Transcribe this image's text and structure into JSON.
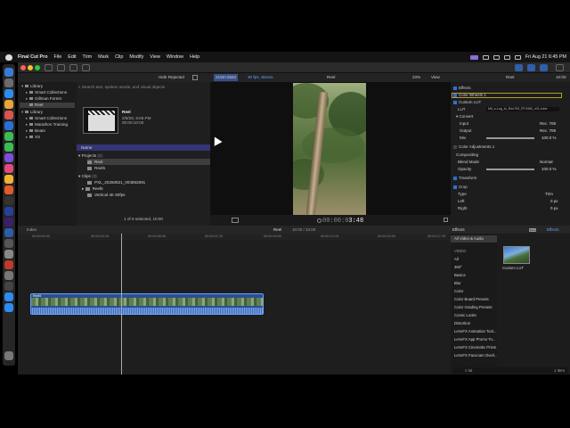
{
  "menubar": {
    "app_name": "Final Cut Pro",
    "items": [
      "File",
      "Edit",
      "Trim",
      "Mark",
      "Clip",
      "Modify",
      "View",
      "Window",
      "Help"
    ],
    "clock": "Fri Aug 21  6:45 PM"
  },
  "browser_header": {
    "filter": "Hide Rejected",
    "format": "2160×3840",
    "rate": "30 fps, Stereo"
  },
  "viewer_header": {
    "title": "Reel",
    "zoom": "23%",
    "view": "View"
  },
  "inspector_header": {
    "title": "Reel",
    "duration": "10:00"
  },
  "sidebar": {
    "items": [
      {
        "label": "Library",
        "kind": "library"
      },
      {
        "label": "Smart Collections",
        "kind": "folder"
      },
      {
        "label": "Gillman Forest",
        "kind": "folder"
      },
      {
        "label": "Reel",
        "kind": "event",
        "selected": true
      },
      {
        "label": "Library",
        "kind": "library"
      },
      {
        "label": "Smart Collections",
        "kind": "folder"
      },
      {
        "label": "Marathon Training",
        "kind": "folder"
      },
      {
        "label": "Beats",
        "kind": "folder"
      },
      {
        "label": "XS",
        "kind": "folder"
      }
    ]
  },
  "browser": {
    "search_placeholder": "Search text, spoken words, and visual objects",
    "clip_name": "Reel",
    "clip_date": "2/8/26, 9:06 PM",
    "clip_duration": "00:00:10:00",
    "list_header": "Name",
    "projects_label": "Projects",
    "projects_count": "(2)",
    "projects": [
      "Reel",
      "Reel5"
    ],
    "clips_label": "Clips",
    "clips_count": "(3)",
    "clips": [
      "PXL_20250821_003852891",
      "Reel5",
      "Vertical 4K 60fps"
    ],
    "status": "1 of 5 selected, 10:00"
  },
  "viewer": {
    "timecode_dim": "00:00:0",
    "timecode": "3:48"
  },
  "inspector": {
    "sections": {
      "effects": "Effects",
      "color_wheels": "Color Wheels 1",
      "custom_lut": "Custom LUT",
      "lut_label": "LUT",
      "lut_value": "Mit_s-Log_to_Rec709_RT4380_v01.cube",
      "convert": "Convert",
      "input_label": "Input",
      "input_value": "Rec. 709",
      "output_label": "Output",
      "output_value": "Rec. 709",
      "mix_label": "Mix",
      "mix_value": "100.0 %",
      "color_adjustments": "Color Adjustments 1",
      "compositing": "Compositing",
      "blend_mode_label": "Blend Mode",
      "blend_mode_value": "Normal",
      "opacity_label": "Opacity",
      "opacity_value": "100.0 %",
      "transform": "Transform",
      "crop": "Crop",
      "type_label": "Type",
      "type_value": "Trim",
      "left_label": "Left",
      "left_value": "0 px",
      "right_label": "Right",
      "right_value": "0 px",
      "save_preset": "Save Effects Preset"
    },
    "mix_fraction": 1.0,
    "opacity_fraction": 1.0
  },
  "timeline_bar": {
    "index": "Index",
    "project": "Reel",
    "position": "10:00 / 10:00",
    "effects_tab": "Effects",
    "effects_right": "Effects"
  },
  "timeline": {
    "ruler": [
      "00:00:00:00",
      "00:00:02:15",
      "00:00:05:00",
      "00:00:07:15",
      "00:00:10:00",
      "00:00:12:15",
      "00:00:15:00",
      "00:00:17:15"
    ],
    "clip_label": "Reel5"
  },
  "effects": {
    "categories": [
      "All Video & Audio",
      "VIDEO",
      "All",
      "360°",
      "Basics",
      "Blur",
      "Color",
      "Color Board Presets",
      "Color Grading Presets",
      "Comic Looks",
      "Distortion",
      "LensFX Animation Tool...",
      "LensFX App Promo To...",
      "LensFX Cinematic Prism",
      "LensFX Facecam Overl..."
    ],
    "selected_effect": "Custom LUT",
    "search_value": "lut",
    "item_count": "1 Item"
  },
  "colors": {
    "accent_blue": "#2f6fd6",
    "clip_blue": "#2a4f92",
    "list_header": "#343476",
    "selection_outline": "#b79a2d"
  }
}
